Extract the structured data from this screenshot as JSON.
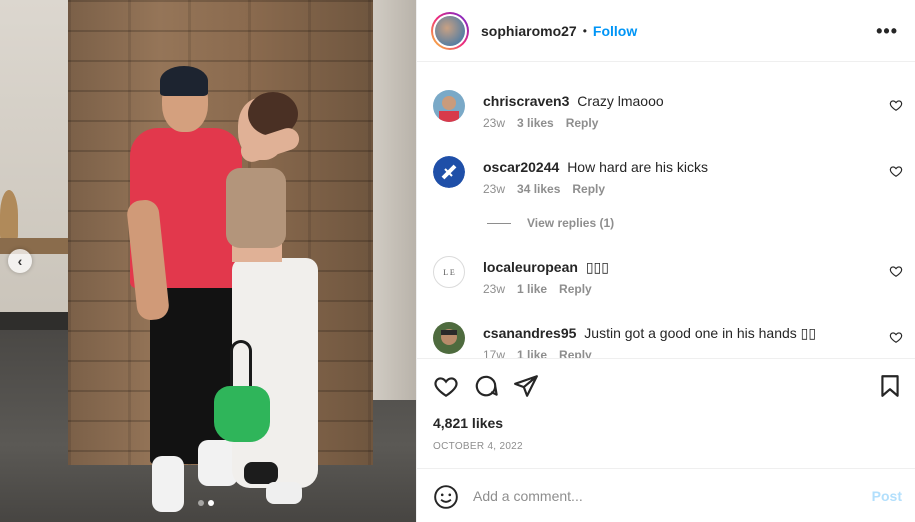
{
  "post": {
    "username": "sophiaromo27",
    "separator": "•",
    "follow_label": "Follow",
    "more_icon": "more-options-icon",
    "more_glyph": "•••"
  },
  "carousel": {
    "prev_glyph": "‹",
    "slide_count": 2,
    "active_slide": 2
  },
  "comments": [
    {
      "username": "chriscraven3",
      "text": "Crazy lmaooo",
      "age": "23w",
      "likes": "3 likes",
      "reply": "Reply"
    },
    {
      "username": "oscar20244",
      "text": "How hard are his kicks",
      "age": "23w",
      "likes": "34 likes",
      "reply": "Reply"
    },
    {
      "username": "localeuropean",
      "text": "▯▯▯",
      "age": "23w",
      "likes": "1 like",
      "reply": "Reply"
    },
    {
      "username": "csanandres95",
      "text": "Justin got a good one in his hands ▯▯",
      "age": "17w",
      "likes": "1 like",
      "reply": "Reply"
    }
  ],
  "view_replies": "View replies (1)",
  "localeuropean_avatar_text": "L E",
  "actions": {
    "likes": "4,821 likes",
    "date": "OCTOBER 4, 2022",
    "icons": [
      "heart-icon",
      "comment-icon",
      "share-icon",
      "bookmark-icon"
    ]
  },
  "add_comment": {
    "placeholder": "Add a comment...",
    "post_label": "Post"
  },
  "colors": {
    "follow_blue": "#0095f6",
    "post_disabled": "#b2dffc",
    "muted": "#8e8e8e"
  }
}
